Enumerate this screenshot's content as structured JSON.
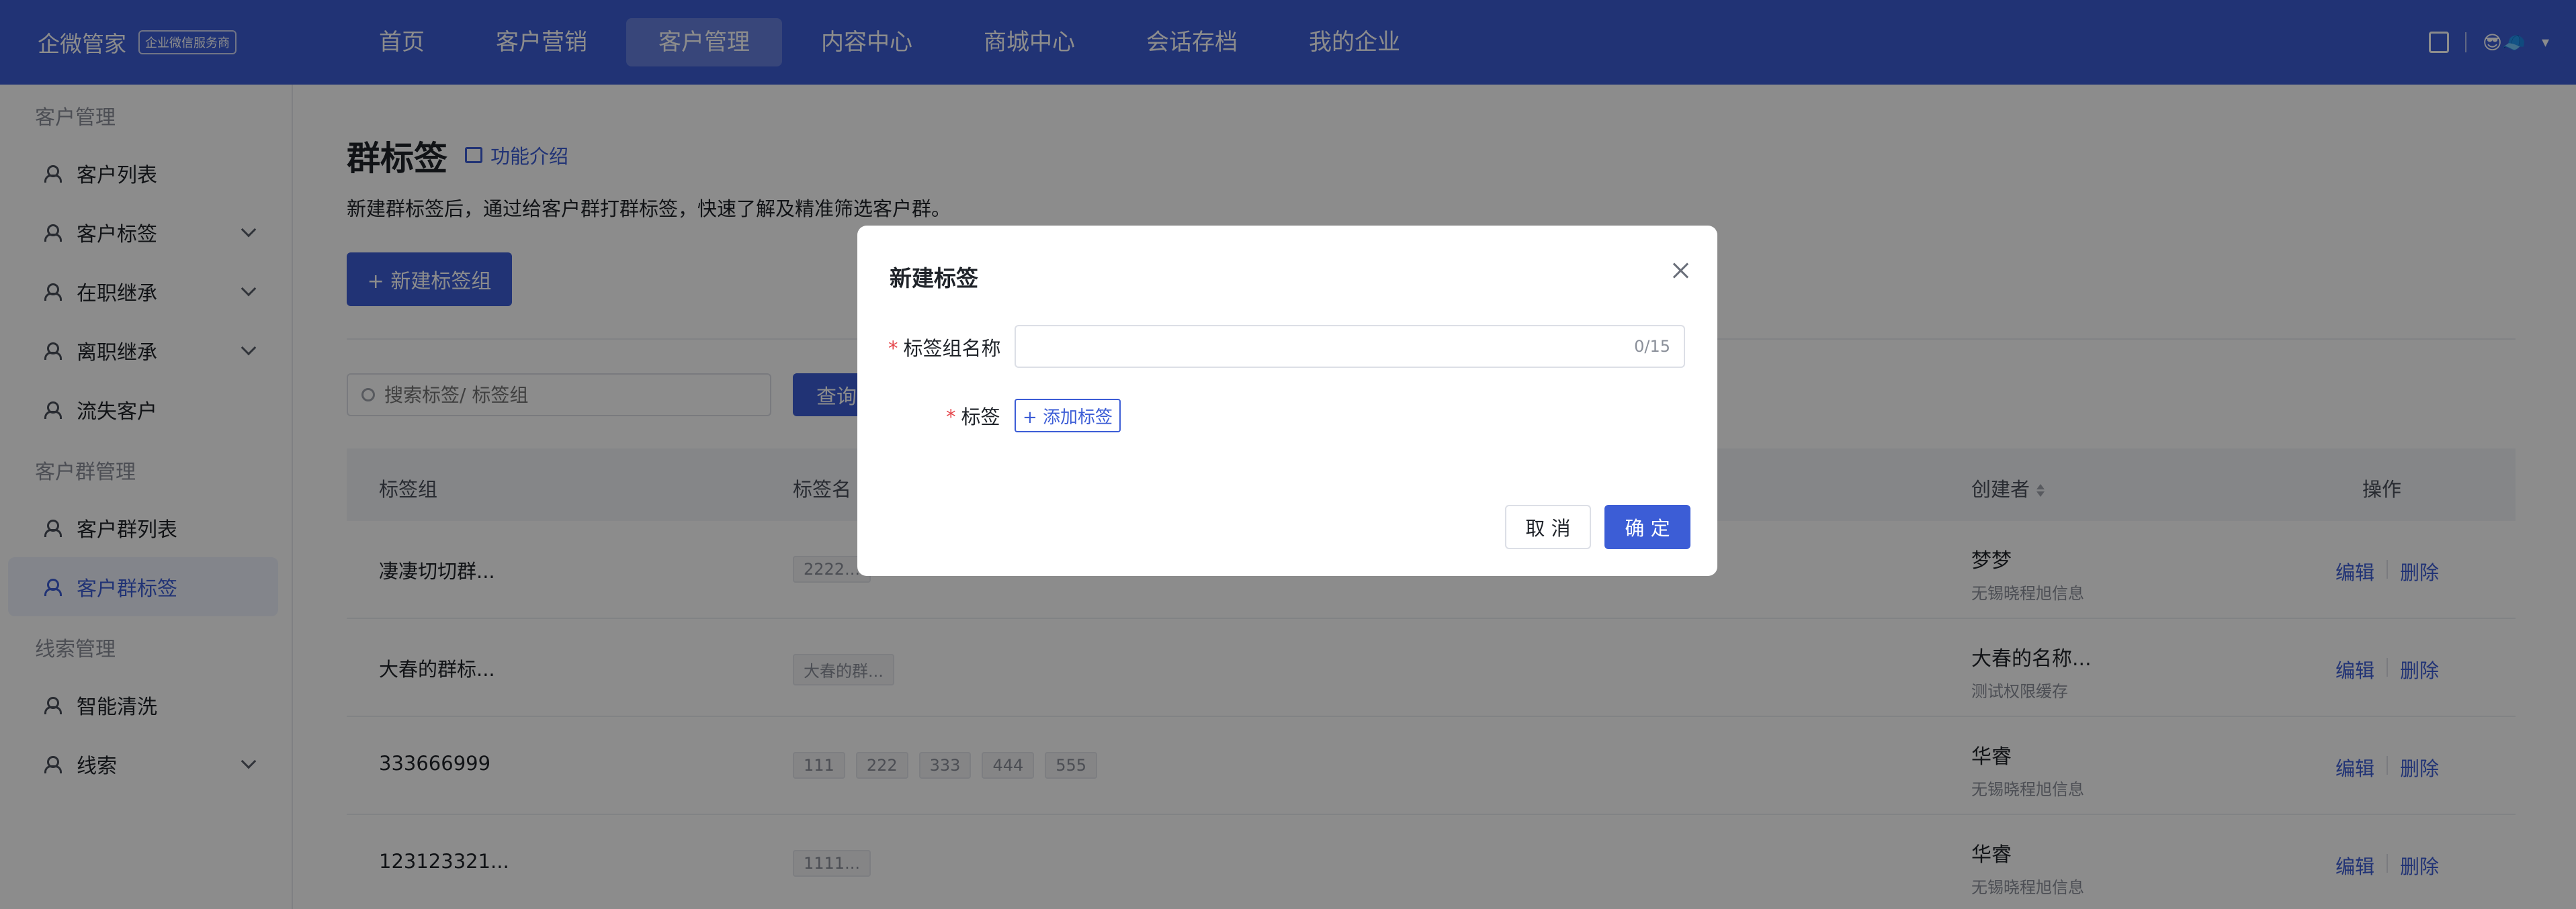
{
  "app": {
    "brand": "企微管家",
    "brand_badge": "企业微信服务商"
  },
  "nav": [
    "首页",
    "客户营销",
    "客户管理",
    "内容中心",
    "商城中心",
    "会话存档",
    "我的企业"
  ],
  "sidebar": {
    "group1": "客户管理",
    "g1_items": [
      "客户列表",
      "客户标签",
      "在职继承",
      "离职继承",
      "流失客户"
    ],
    "group2": "客户群管理",
    "g2_items": [
      "客户群列表",
      "客户群标签"
    ],
    "group3": "线索管理",
    "g3_items": [
      "智能清洗",
      "线索"
    ]
  },
  "page": {
    "title": "群标签",
    "feature_link": "功能介绍",
    "desc": "新建群标签后，通过给客户群打群标签，快速了解及精准筛选客户群。",
    "new_button": "+ 新建标签组",
    "search_placeholder": "搜索标签/ 标签组",
    "query_button": "查询"
  },
  "table": {
    "headers": {
      "group": "标签组",
      "tags": "标签名",
      "creator": "创建者",
      "ops": "操作"
    },
    "edit": "编辑",
    "delete": "删除",
    "rows": [
      {
        "group": "凄凄切切群...",
        "tags": [
          "2222..."
        ],
        "creator": "梦梦",
        "org": "无锡晓程旭信息"
      },
      {
        "group": "大春的群标...",
        "tags": [
          "大春的群..."
        ],
        "creator": "大春的名称...",
        "org": "测试权限缓存"
      },
      {
        "group": "333666999",
        "tags": [
          "111",
          "222",
          "333",
          "444",
          "555"
        ],
        "creator": "华睿",
        "org": "无锡晓程旭信息"
      },
      {
        "group": "123123321...",
        "tags": [
          "1111..."
        ],
        "creator": "华睿",
        "org": "无锡晓程旭信息"
      }
    ]
  },
  "modal": {
    "title": "新建标签",
    "name_label": "标签组名称",
    "name_value": "",
    "name_count": "0/15",
    "tag_label": "标签",
    "add_tag": "+ 添加标签",
    "cancel": "取 消",
    "ok": "确 定"
  }
}
